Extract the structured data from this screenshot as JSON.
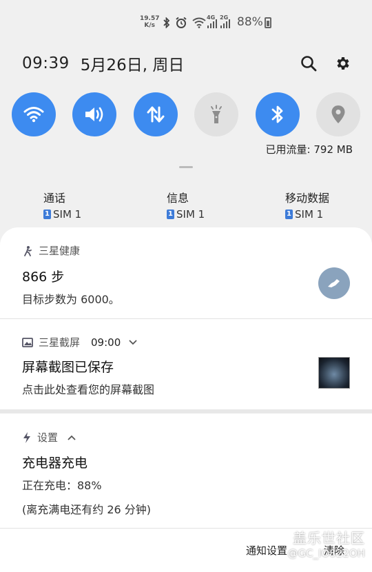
{
  "status_bar": {
    "net_speed": "19.57\nK/s",
    "net_speed_value": "19.57",
    "net_speed_unit": "K/s",
    "signal_4g": "4G",
    "signal_2g": "2G",
    "battery_percent": "88%",
    "icons": [
      "bluetooth-icon",
      "alarm-icon",
      "wifi-icon",
      "signal-icon",
      "battery-charging-icon"
    ]
  },
  "header": {
    "time": "09:39",
    "date": "5月26日, 周日"
  },
  "quick_toggles": [
    {
      "name": "wifi",
      "state": "on"
    },
    {
      "name": "sound",
      "state": "on"
    },
    {
      "name": "mobile-data",
      "state": "on"
    },
    {
      "name": "flashlight",
      "state": "off"
    },
    {
      "name": "bluetooth",
      "state": "on"
    },
    {
      "name": "location",
      "state": "off"
    }
  ],
  "data_usage": "已用流量: 792 MB",
  "sim_prefs": [
    {
      "title": "通话",
      "sim": "SIM 1",
      "badge": "1"
    },
    {
      "title": "信息",
      "sim": "SIM 1",
      "badge": "1"
    },
    {
      "title": "移动数据",
      "sim": "SIM 1",
      "badge": "1"
    }
  ],
  "notifications": {
    "health": {
      "app": "三星健康",
      "title": "866 步",
      "body": "目标步数为 6000。"
    },
    "screenshot": {
      "app": "三星截屏",
      "time": "09:00",
      "title": "屏幕截图已保存",
      "body": "点击此处查看您的屏幕截图"
    },
    "settings": {
      "app": "设置",
      "title": "充电器充电",
      "body": "正在充电：88%",
      "body2": "(离充满电还有约 26 分钟)"
    }
  },
  "footer": {
    "notification_settings": "通知设置",
    "clear": "清除"
  },
  "watermark": {
    "line1": "盖乐世社区",
    "line2": "@GC_IO822OH"
  },
  "colors": {
    "accent": "#3d8bf0",
    "toggle_off": "#e1e1e1",
    "panel": "#ffffff",
    "background": "#f0f0f0"
  }
}
